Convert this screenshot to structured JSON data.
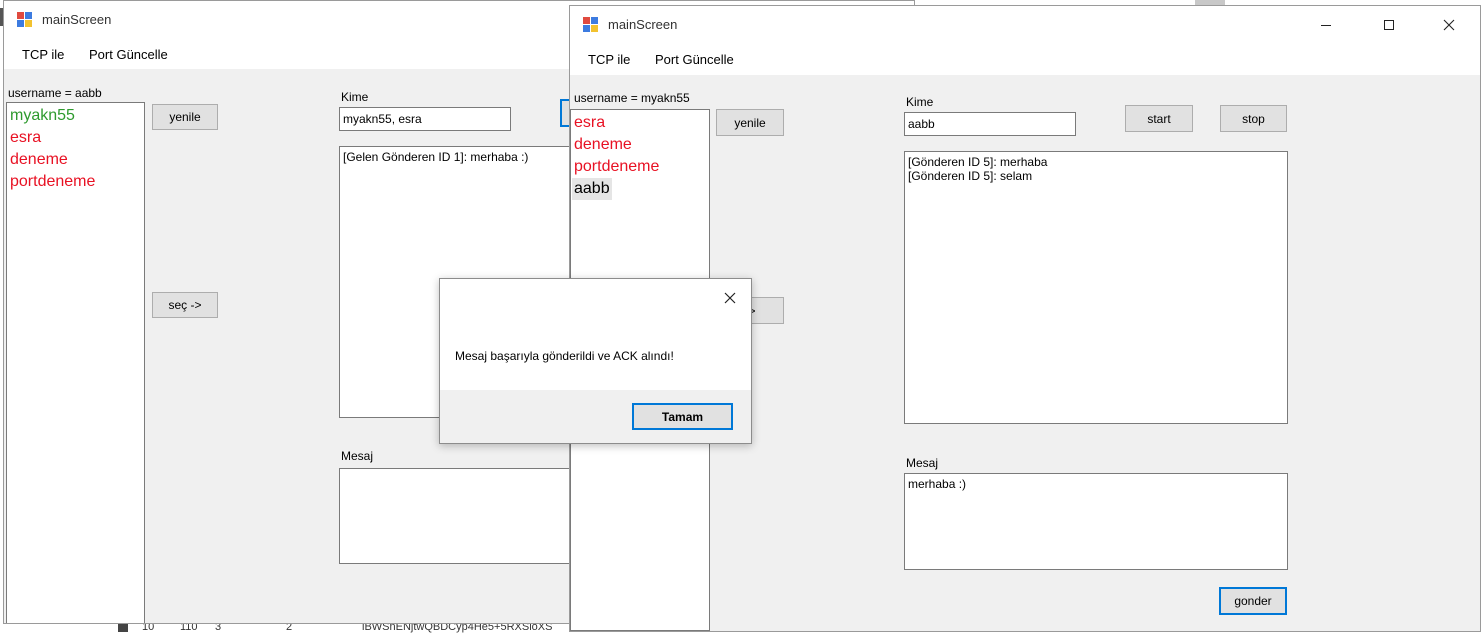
{
  "colors": {
    "online": "#2e9a2e",
    "offline": "#e81123",
    "accent": "#0078d7"
  },
  "background_strip": {
    "cells": [
      "10",
      "110",
      "3",
      "2",
      "iBWSnENjtwQBDCyp4He5+5RXSloXS"
    ]
  },
  "window_left": {
    "title": "mainScreen",
    "icon": "windows-forms-app-icon",
    "menu": [
      "TCP ile",
      "Port Güncelle"
    ],
    "username_label": "username =  aabb",
    "users": [
      {
        "name": "myakn55",
        "status": "online"
      },
      {
        "name": "esra",
        "status": "offline"
      },
      {
        "name": "deneme",
        "status": "offline"
      },
      {
        "name": "portdeneme",
        "status": "offline"
      }
    ],
    "refresh_button": "yenile",
    "select_button": "seç ->",
    "to_label": "Kime",
    "to_value": "myakn55, esra",
    "incoming_messages": "[Gelen Gönderen ID 1]: merhaba :)",
    "message_label": "Mesaj",
    "message_value": ""
  },
  "window_right": {
    "title": "mainScreen",
    "icon": "windows-forms-app-icon",
    "menu": [
      "TCP ile",
      "Port Güncelle"
    ],
    "username_label": "username =  myakn55",
    "users": [
      {
        "name": "esra",
        "status": "offline"
      },
      {
        "name": "deneme",
        "status": "offline"
      },
      {
        "name": "portdeneme",
        "status": "offline"
      },
      {
        "name": "aabb",
        "status": "selected"
      }
    ],
    "refresh_button": "yenile",
    "select_button": "->",
    "to_label": "Kime",
    "to_value": "aabb",
    "start_button": "start",
    "stop_button": "stop",
    "incoming_messages": "[Gönderen ID 5]: merhaba\n[Gönderen ID 5]: selam",
    "message_label": "Mesaj",
    "message_value": "merhaba :)",
    "send_button": "gonder",
    "minimize_icon": "minimize-icon",
    "maximize_icon": "maximize-icon",
    "close_icon": "close-icon"
  },
  "dialog": {
    "message": "Mesaj başarıyla gönderildi ve ACK alındı!",
    "ok_button": "Tamam",
    "close_icon": "close-icon"
  }
}
